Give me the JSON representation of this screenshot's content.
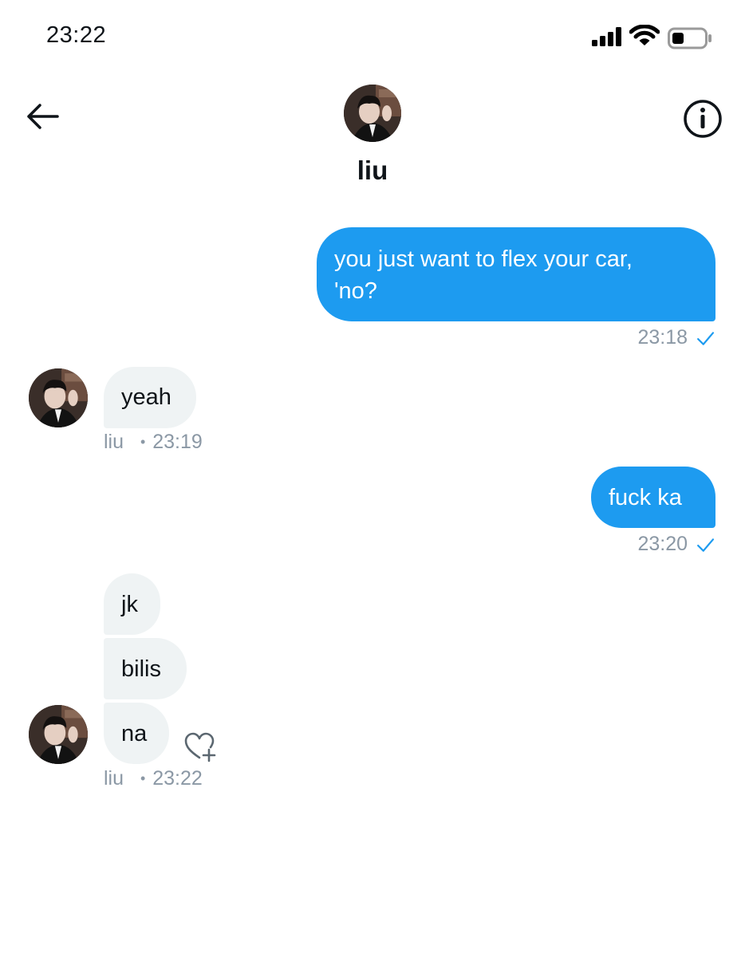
{
  "status_bar": {
    "time": "23:22"
  },
  "header": {
    "name": "liu"
  },
  "messages": {
    "m1": {
      "text_line1": "you just want to flex your car,",
      "text_line2": "'no?",
      "time": "23:18"
    },
    "m2": {
      "text": "yeah",
      "sender": "liu",
      "dot": "•",
      "time": "23:19"
    },
    "m3": {
      "text": "fuck ka",
      "time": "23:20"
    },
    "m4": {
      "lines": [
        "jk",
        "bilis",
        "na"
      ],
      "sender": "liu",
      "dot": "•",
      "time": "23:22"
    }
  },
  "icons": {
    "back": "arrow-left-icon",
    "info": "info-icon",
    "read_receipt": "checkmark-icon",
    "reaction": "heart-plus-icon"
  },
  "colors": {
    "accent": "#1d9bf0",
    "incoming_bubble": "#eff3f4",
    "meta_text": "#8b98a5"
  }
}
